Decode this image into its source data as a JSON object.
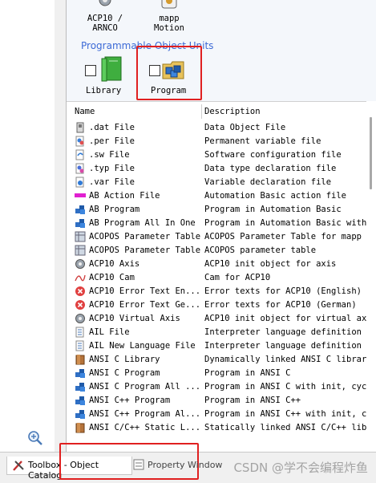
{
  "units_top": [
    {
      "label_line1": "ACP10 /",
      "label_line2": "ARNCO",
      "icon": "gear-icon"
    },
    {
      "label_line1": "mapp",
      "label_line2": "Motion",
      "icon": "mapp-motion-icon"
    }
  ],
  "group_header": "Programmable Object Units",
  "units_programmable": [
    {
      "label": "Library",
      "icon": "library-book-icon"
    },
    {
      "label": "Program",
      "icon": "program-folder-icon"
    }
  ],
  "list": {
    "columns": [
      "Name",
      "Description"
    ],
    "rows": [
      {
        "name": ".dat File",
        "desc": "Data Object File",
        "icon": "dat-file-icon"
      },
      {
        "name": ".per File",
        "desc": "Permanent variable file",
        "icon": "per-file-icon"
      },
      {
        "name": ".sw File",
        "desc": "Software configuration file",
        "icon": "sw-file-icon"
      },
      {
        "name": ".typ File",
        "desc": "Data type declaration file",
        "icon": "typ-file-icon"
      },
      {
        "name": ".var File",
        "desc": "Variable declaration file",
        "icon": "var-file-icon"
      },
      {
        "name": "AB Action File",
        "desc": "Automation Basic action file",
        "icon": "action-file-icon"
      },
      {
        "name": "AB Program",
        "desc": "Program in Automation Basic",
        "icon": "program-blocks-icon"
      },
      {
        "name": "AB Program All In One",
        "desc": "Program in Automation Basic with",
        "icon": "program-blocks-icon"
      },
      {
        "name": "ACOPOS Parameter Table",
        "desc": "ACOPOS Parameter Table for mapp M",
        "icon": "parameter-table-icon"
      },
      {
        "name": "ACOPOS Parameter Table",
        "desc": "ACOPOS parameter table",
        "icon": "parameter-table-icon"
      },
      {
        "name": "ACP10 Axis",
        "desc": "ACP10 init object for axis",
        "icon": "axis-gear-icon"
      },
      {
        "name": "ACP10 Cam",
        "desc": "Cam for ACP10",
        "icon": "cam-curve-icon"
      },
      {
        "name": "ACP10 Error Text En...",
        "desc": "Error texts for ACP10 (English)",
        "icon": "error-text-icon"
      },
      {
        "name": "ACP10 Error Text Ge...",
        "desc": "Error texts for ACP10 (German)",
        "icon": "error-text-icon"
      },
      {
        "name": "ACP10 Virtual Axis",
        "desc": "ACP10 init object for virtual ax",
        "icon": "axis-gear-icon"
      },
      {
        "name": "AIL File",
        "desc": "Interpreter language definition",
        "icon": "ail-file-icon"
      },
      {
        "name": "AIL New Language File",
        "desc": "Interpreter language definition",
        "icon": "ail-file-icon"
      },
      {
        "name": "ANSI C Library",
        "desc": "Dynamically linked ANSI C library",
        "icon": "c-library-icon"
      },
      {
        "name": "ANSI C Program",
        "desc": "Program in ANSI C",
        "icon": "program-blocks-icon"
      },
      {
        "name": "ANSI C Program All ...",
        "desc": "Program in ANSI C with init, cyc",
        "icon": "program-blocks-icon"
      },
      {
        "name": "ANSI C++ Program",
        "desc": "Program in ANSI C++",
        "icon": "program-blocks-icon"
      },
      {
        "name": "ANSI C++ Program Al...",
        "desc": "Program in ANSI C++ with init, c",
        "icon": "program-blocks-icon"
      },
      {
        "name": "ANSI C/C++ Static L...",
        "desc": "Statically linked ANSI C/C++ lib",
        "icon": "c-library-icon"
      }
    ]
  },
  "tabs": {
    "toolbox": "Toolbox - Object Catalog",
    "property": "Property Window"
  },
  "watermark": "CSDN @学不会编程炸鱼",
  "colors": {
    "highlight_red": "#e02020",
    "group_header_blue": "#3c6ad6"
  }
}
